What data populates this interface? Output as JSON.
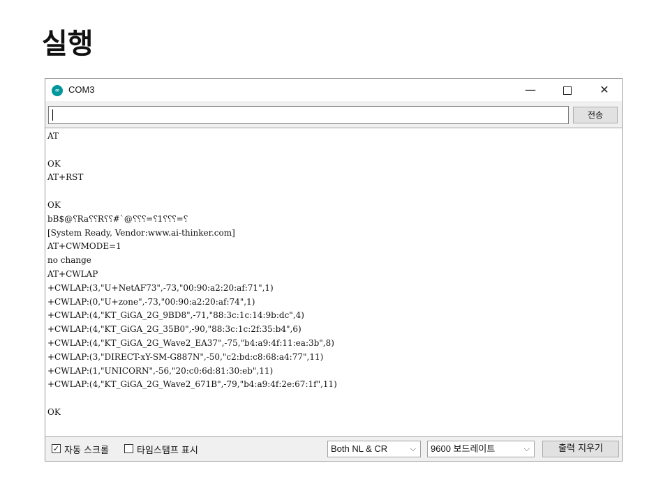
{
  "slide": {
    "title": "실행"
  },
  "window": {
    "title": "COM3",
    "app_icon": "arduino-icon",
    "controls": {
      "minimize": "—",
      "maximize": "maximize-icon",
      "close": "✕"
    }
  },
  "send_row": {
    "input_value": "",
    "send_label": "전송"
  },
  "console": {
    "lines": [
      "AT",
      "",
      "OK",
      "AT+RST",
      "",
      "OK",
      "bB$@⸮Ra⸮⸮R⸮⸮#`@⸮⸮⸮=⸮1⸮⸮⸮=⸮",
      "[System Ready, Vendor:www.ai-thinker.com]",
      "AT+CWMODE=1",
      "no change",
      "AT+CWLAP",
      "+CWLAP:(3,\"U+NetAF73\",-73,\"00:90:a2:20:af:71\",1)",
      "+CWLAP:(0,\"U+zone\",-73,\"00:90:a2:20:af:74\",1)",
      "+CWLAP:(4,\"KT_GiGA_2G_9BD8\",-71,\"88:3c:1c:14:9b:dc\",4)",
      "+CWLAP:(4,\"KT_GiGA_2G_35B0\",-90,\"88:3c:1c:2f:35:b4\",6)",
      "+CWLAP:(4,\"KT_GiGA_2G_Wave2_EA37\",-75,\"b4:a9:4f:11:ea:3b\",8)",
      "+CWLAP:(3,\"DIRECT-xY-SM-G887N\",-50,\"c2:bd:c8:68:a4:77\",11)",
      "+CWLAP:(1,\"UNICORN\",-56,\"20:c0:6d:81:30:eb\",11)",
      "+CWLAP:(4,\"KT_GiGA_2G_Wave2_671B\",-79,\"b4:a9:4f:2e:67:1f\",11)",
      "",
      "OK"
    ]
  },
  "bottom_bar": {
    "autoscroll_label": "자동 스크롤",
    "autoscroll_checked": true,
    "timestamp_label": "타임스탬프 표시",
    "timestamp_checked": false,
    "line_ending": "Both NL & CR",
    "baud_rate": "9600 보드레이트",
    "clear_label": "출력 지우기",
    "dropdown_arrow": "⌵"
  },
  "colors": {
    "arduino_teal": "#00979c",
    "window_bg": "#f0f0f0"
  }
}
